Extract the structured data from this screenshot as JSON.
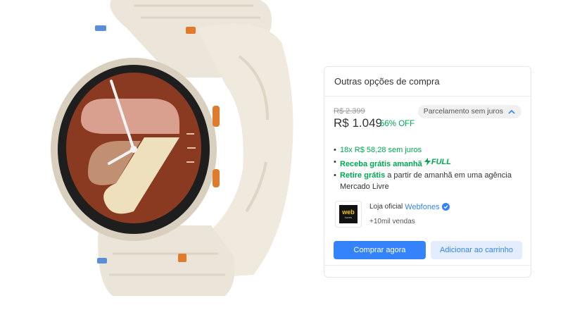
{
  "product": {
    "image_icon": "smartwatch-image"
  },
  "panel": {
    "title": "Outras opções de compra",
    "old_price": "R$ 2.399",
    "price": "R$ 1.049",
    "discount": "56% OFF",
    "installments_label": "Parcelamento sem juros",
    "installments_icon": "chevron-up-icon",
    "bullets": {
      "installment": "18x R$ 58,28 sem juros",
      "free_shipping": "Receba grátis amanhã",
      "full_label": "FULL",
      "pickup_bold": "Retire grátis",
      "pickup_rest": " a partir de amanhã em uma agência Mercado Livre"
    },
    "seller": {
      "logo_text": "web",
      "logo_sub": "fones",
      "prefix": "Loja oficial",
      "name": "Webfones",
      "verified_icon": "verified-badge-icon",
      "sales": "+10mil vendas"
    },
    "buy_label": "Comprar agora",
    "cart_label": "Adicionar ao carrinho"
  },
  "colors": {
    "accent_blue": "#3483fa",
    "green": "#00a650"
  }
}
